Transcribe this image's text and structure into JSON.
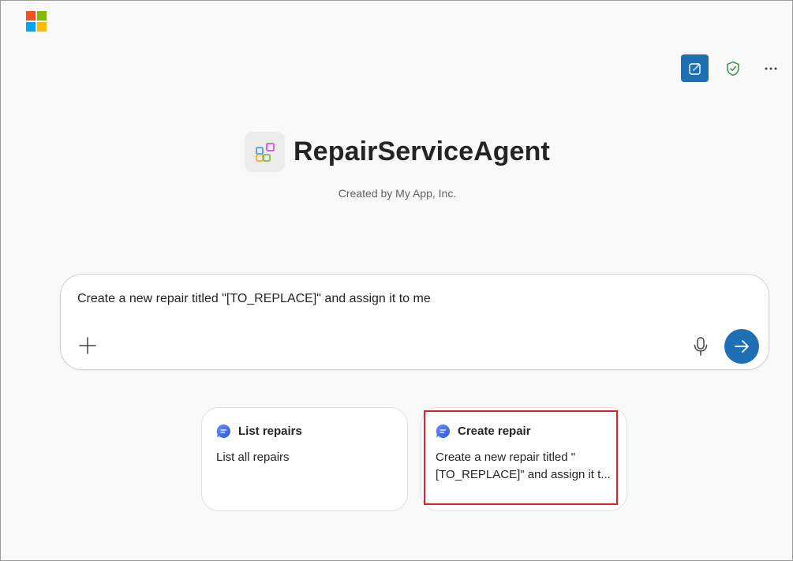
{
  "header": {
    "brand_icon": "microsoft-logo",
    "actions": [
      {
        "icon": "new-chat-icon"
      },
      {
        "icon": "shield-check-icon"
      },
      {
        "icon": "more-options-icon"
      }
    ]
  },
  "agent": {
    "name": "RepairServiceAgent",
    "creator": "Created by My App, Inc.",
    "icon": "agent-grid-icon"
  },
  "composer": {
    "text": "Create a new repair titled \"[TO_REPLACE]\" and assign it to me",
    "add_icon": "plus-icon",
    "mic_icon": "microphone-icon",
    "send_icon": "arrow-right-icon"
  },
  "suggestions": [
    {
      "title": "List repairs",
      "description": "List all repairs",
      "icon": "chat-bubble-icon"
    },
    {
      "title": "Create repair",
      "description": "Create a new repair titled \" [TO_REPLACE]\" and assign it t...",
      "icon": "chat-bubble-icon",
      "highlighted": true
    }
  ],
  "colors": {
    "accent": "#1f6fb5",
    "highlight_border": "#e0202a",
    "shield_green": "#2e8b3a"
  }
}
